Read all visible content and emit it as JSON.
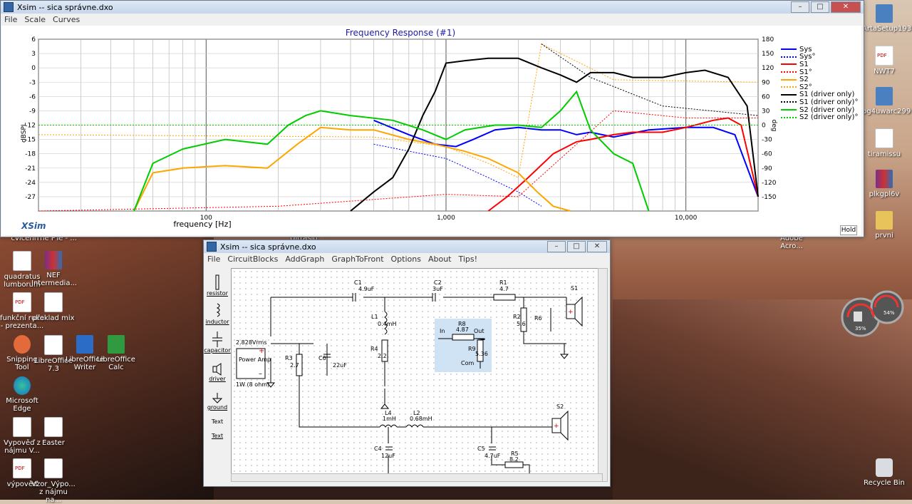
{
  "graph_window": {
    "title": "Xsim -- sica správne.dxo",
    "menu": [
      "File",
      "Scale",
      "Curves"
    ],
    "chart_title": "Frequency Response (#1)",
    "brand": "XSim",
    "hold_label": "Hold",
    "xlabel": "frequency [Hz]",
    "ylabel_left": "dBSPL",
    "ylabel_right": "deg",
    "x_ticks": [
      "100",
      "1,000",
      "10,000"
    ],
    "y_left_ticks": [
      "6",
      "3",
      "0",
      "-3",
      "-6",
      "-9",
      "-12",
      "-15",
      "-18",
      "-21",
      "-24",
      "-27"
    ],
    "y_right_ticks": [
      "180",
      "150",
      "120",
      "90",
      "60",
      "30",
      "0",
      "-30",
      "-60",
      "-90",
      "-120",
      "-150"
    ]
  },
  "chart_data": {
    "type": "line",
    "title": "Frequency Response (#1)",
    "xlabel": "frequency [Hz]",
    "ylabel": "dBSPL",
    "y2label": "deg",
    "xscale": "log",
    "xlim": [
      20,
      20000
    ],
    "ylim": [
      -30,
      6
    ],
    "y2lim": [
      -180,
      180
    ],
    "legend_position": "right",
    "series": [
      {
        "name": "Sys",
        "color": "#0000ff",
        "style": "solid",
        "axis": "left",
        "x": [
          500,
          700,
          900,
          1100,
          1300,
          1600,
          2000,
          2500,
          3000,
          3500,
          4000,
          5000,
          7000,
          10000,
          13000,
          16000,
          20000
        ],
        "y": [
          -11,
          -14,
          -16,
          -16.5,
          -15,
          -13,
          -12.5,
          -13,
          -13,
          -14,
          -13.5,
          -14.5,
          -13,
          -12.5,
          -12.5,
          -14,
          -27
        ]
      },
      {
        "name": "Sys°",
        "color": "#0000ff",
        "style": "dotted",
        "axis": "right",
        "x": [
          500,
          1000,
          1500,
          2000,
          2500
        ],
        "y": [
          -40,
          -70,
          -110,
          -140,
          -170
        ]
      },
      {
        "name": "S1",
        "color": "#ff0000",
        "style": "solid",
        "axis": "left",
        "x": [
          1500,
          1800,
          2200,
          2800,
          3500,
          4000,
          5000,
          6000,
          8000,
          10000,
          13000,
          15000,
          17000,
          20000
        ],
        "y": [
          -30,
          -27,
          -23,
          -18,
          -15.5,
          -15,
          -14,
          -13.5,
          -13.5,
          -12.5,
          -11,
          -10.5,
          -12,
          -27
        ]
      },
      {
        "name": "S1°",
        "color": "#ff0000",
        "style": "dotted",
        "axis": "right",
        "x": [
          20,
          200,
          1000,
          2000,
          5000,
          10000,
          20000
        ],
        "y": [
          -180,
          -170,
          -145,
          -150,
          30,
          15,
          15
        ]
      },
      {
        "name": "S2",
        "color": "#ffa500",
        "style": "solid",
        "axis": "left",
        "x": [
          50,
          60,
          80,
          120,
          180,
          240,
          300,
          400,
          500,
          700,
          900,
          1200,
          1500,
          2000,
          2400,
          2800,
          3300
        ],
        "y": [
          -30,
          -22,
          -21,
          -20.5,
          -21,
          -16,
          -12.5,
          -13,
          -13,
          -15,
          -16,
          -17.5,
          -19,
          -22,
          -26,
          -29,
          -30
        ]
      },
      {
        "name": "S2°",
        "color": "#ffa500",
        "style": "dotted",
        "axis": "right",
        "x": [
          20,
          500,
          1000,
          1500,
          2000,
          2500,
          5000,
          20000
        ],
        "y": [
          -20,
          -25,
          -45,
          -80,
          -110,
          170,
          95,
          90
        ]
      },
      {
        "name": "S1 (driver only)",
        "color": "#000000",
        "style": "solid",
        "axis": "left",
        "x": [
          400,
          500,
          600,
          700,
          800,
          900,
          1000,
          1200,
          1500,
          2000,
          2500,
          3000,
          3500,
          4000,
          5000,
          6000,
          8000,
          10000,
          12000,
          15000,
          18000,
          20000
        ],
        "y": [
          -30,
          -26,
          -23,
          -17,
          -10,
          -5,
          1,
          1.5,
          2,
          2,
          0,
          -1.5,
          -3,
          -1,
          -1,
          -2,
          -2,
          -1,
          -0.5,
          -2,
          -8,
          -27
        ]
      },
      {
        "name": "S1 (driver only)°",
        "color": "#000000",
        "style": "dotted",
        "axis": "right",
        "x": [
          2500,
          4000,
          8000,
          20000
        ],
        "y": [
          170,
          100,
          40,
          20
        ]
      },
      {
        "name": "S2 (driver only)",
        "color": "#00cc00",
        "style": "solid",
        "axis": "left",
        "x": [
          50,
          60,
          80,
          120,
          180,
          220,
          260,
          300,
          400,
          600,
          800,
          1000,
          1200,
          1600,
          2000,
          2500,
          3000,
          3500,
          4000,
          5000,
          6000,
          7000
        ],
        "y": [
          -30,
          -20,
          -17,
          -15,
          -16,
          -12,
          -10,
          -9,
          -10,
          -11,
          -13,
          -15,
          -13,
          -12,
          -12,
          -12.5,
          -9,
          -5,
          -13,
          -18,
          -20,
          -30
        ]
      },
      {
        "name": "S2 (driver only)°",
        "color": "#00cc00",
        "style": "dotted",
        "axis": "right",
        "x": [
          20,
          20000
        ],
        "y": [
          0,
          0
        ]
      }
    ]
  },
  "schematic_window": {
    "title": "Xsim -- sica správne.dxo",
    "menu": [
      "File",
      "CircuitBlocks",
      "AddGraph",
      "GraphToFront",
      "Options",
      "About",
      "Tips!"
    ],
    "palette": [
      "resistor",
      "inductor",
      "capacitor",
      "driver",
      "ground",
      "Text",
      "Text"
    ],
    "source_voltage": "2.828Vrms",
    "amp_label": "Power Amp",
    "amp_spec": "1W (8 ohm)",
    "components": [
      {
        "ref": "C1",
        "value": "4.9uF"
      },
      {
        "ref": "C2",
        "value": "3uF"
      },
      {
        "ref": "R1",
        "value": "4.7"
      },
      {
        "ref": "S1",
        "value": ""
      },
      {
        "ref": "L1",
        "value": "0.4mH"
      },
      {
        "ref": "R2",
        "value": "5.6"
      },
      {
        "ref": "R6",
        "value": ""
      },
      {
        "ref": "R3",
        "value": "2.7"
      },
      {
        "ref": "C6",
        "value": "22uF"
      },
      {
        "ref": "R4",
        "value": "2.2"
      },
      {
        "ref": "R8",
        "value": "4.87"
      },
      {
        "ref": "R9",
        "value": "5.36"
      },
      {
        "ref": "L4",
        "value": "1mH"
      },
      {
        "ref": "L2",
        "value": "0.68mH"
      },
      {
        "ref": "S2",
        "value": ""
      },
      {
        "ref": "C4",
        "value": "12uF"
      },
      {
        "ref": "C5",
        "value": "4.7uF"
      },
      {
        "ref": "R5",
        "value": "8.2"
      }
    ],
    "block_labels": {
      "in": "In",
      "out": "Out",
      "com": "Com"
    }
  },
  "desktop": {
    "icons_left": [
      {
        "label": "quadratus lumborum",
        "type": "doc"
      },
      {
        "label": "NEF Intermedia...",
        "type": "rar"
      },
      {
        "label": "funkční ruka - prezenta...",
        "type": "pdf"
      },
      {
        "label": "překlad mix",
        "type": "doc"
      },
      {
        "label": "Snipping Tool",
        "type": "snip"
      },
      {
        "label": "LibreOffice 7.3",
        "type": "doc"
      },
      {
        "label": "LibreOffice Writer",
        "type": "writer"
      },
      {
        "label": "LibreOffice Calc",
        "type": "calc"
      },
      {
        "label": "Microsoft Edge",
        "type": "edge"
      },
      {
        "label": "Vypověď z nájmu V...",
        "type": "doc"
      },
      {
        "label": "Easter",
        "type": "doc"
      },
      {
        "label": "výpověď",
        "type": "pdf"
      },
      {
        "label": "Vzor_Výpo... z nájmu na...",
        "type": "doc"
      }
    ],
    "icons_right": [
      {
        "label": "ArtaSetup193",
        "type": "app"
      },
      {
        "label": "NWT7",
        "type": "pdf"
      },
      {
        "label": "pg4uwarc299",
        "type": "app"
      },
      {
        "label": "tiramissu",
        "type": "doc"
      },
      {
        "label": "plkgpl6v",
        "type": "rar"
      },
      {
        "label": "prvni",
        "type": "folder"
      },
      {
        "label": "Recycle Bin",
        "type": "bin"
      }
    ],
    "partial_labels": [
      "cvičení",
      "The PTe - ...",
      "Ultraslo...",
      "Adobe Acro..."
    ],
    "gadget": {
      "cpu": "35%",
      "ram": "54%"
    }
  }
}
